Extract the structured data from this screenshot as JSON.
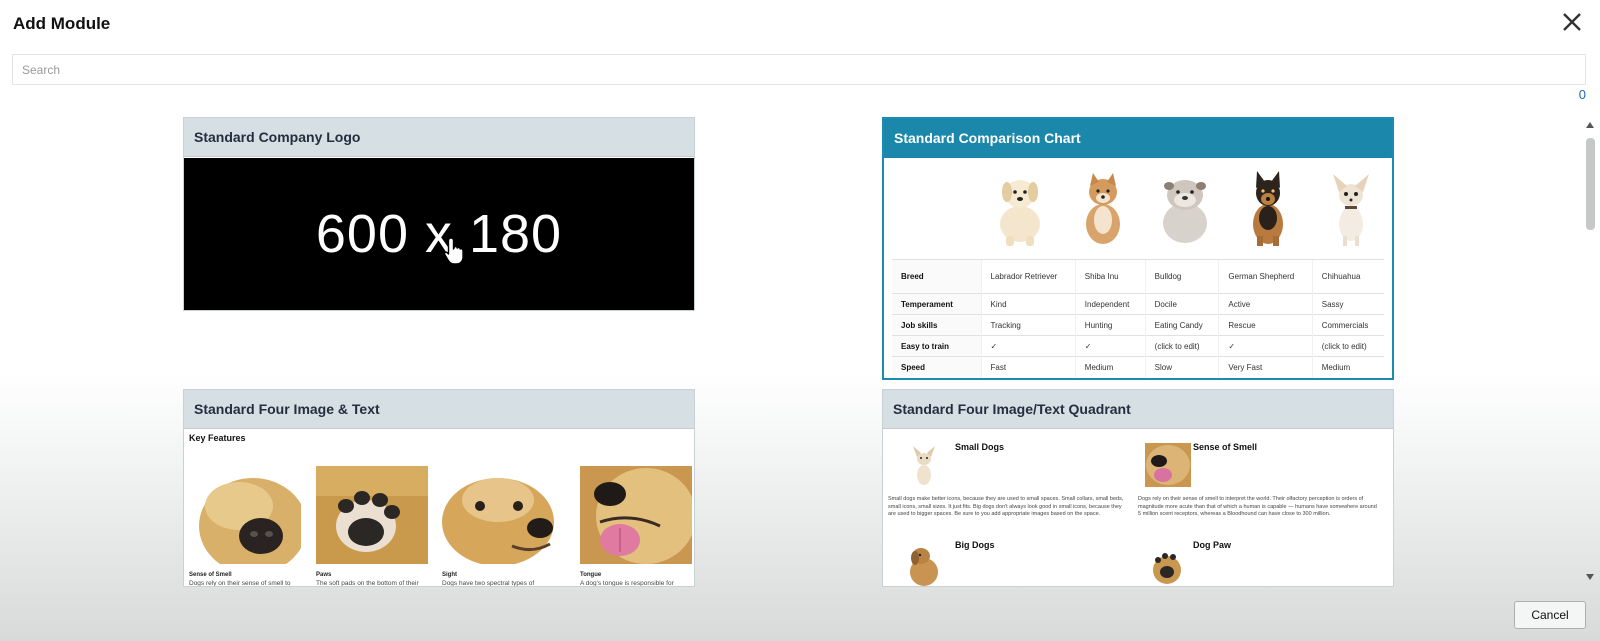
{
  "header": {
    "title": "Add Module"
  },
  "search": {
    "placeholder": "Search",
    "value": ""
  },
  "result_count": "0",
  "modules": {
    "logo": {
      "title": "Standard Company Logo",
      "placeholder_text": "600 x 180"
    },
    "comparison": {
      "title": "Standard Comparison Chart",
      "rows": [
        {
          "label": "Breed",
          "cells": [
            "Labrador Retriever",
            "Shiba Inu",
            "Bulldog",
            "German Shepherd",
            "Chihuahua"
          ]
        },
        {
          "label": "Temperament",
          "cells": [
            "Kind",
            "Independent",
            "Docile",
            "Active",
            "Sassy"
          ]
        },
        {
          "label": "Job skills",
          "cells": [
            "Tracking",
            "Hunting",
            "Eating Candy",
            "Rescue",
            "Commercials"
          ]
        },
        {
          "label": "Easy to train",
          "cells": [
            "✓",
            "✓",
            "(click to edit)",
            "✓",
            "(click to edit)"
          ]
        },
        {
          "label": "Speed",
          "cells": [
            "Fast",
            "Medium",
            "Slow",
            "Very Fast",
            "Medium"
          ]
        }
      ]
    },
    "four_image": {
      "title": "Standard Four Image & Text",
      "heading": "Key Features",
      "items": [
        {
          "caption": "Sense of Smell",
          "body": "Dogs rely on their sense of smell to"
        },
        {
          "caption": "Paws",
          "body": "The soft pads on the bottom of their"
        },
        {
          "caption": "Sight",
          "body": "Dogs have two spectral types of"
        },
        {
          "caption": "Tongue",
          "body": "A dog's tongue is responsible for"
        }
      ]
    },
    "quadrant": {
      "title": "Standard Four Image/Text Quadrant",
      "items": [
        {
          "title": "Small Dogs",
          "body": "Small dogs make better icons, because they are used to small spaces. Small collars, small beds, small icons, small sizes. It just fits. Big dogs don't always look good in small icons, because they are used to bigger spaces. Be sure to you add appropriate images based on the space."
        },
        {
          "title": "Sense of Smell",
          "body": "Dogs rely on their sense of smell to interpret the world. Their olfactory perception is orders of magnitude more acute than that of which a human is capable — humans have somewhere around 5 million scent receptors, whereas a Bloodhound can have close to 300 million."
        },
        {
          "title": "Big Dogs",
          "body": ""
        },
        {
          "title": "Dog Paw",
          "body": ""
        }
      ]
    }
  },
  "footer": {
    "cancel_label": "Cancel"
  },
  "colors": {
    "selected_header": "#1a87ab",
    "card_header": "#d6dfe4",
    "link": "#1a6cae"
  }
}
